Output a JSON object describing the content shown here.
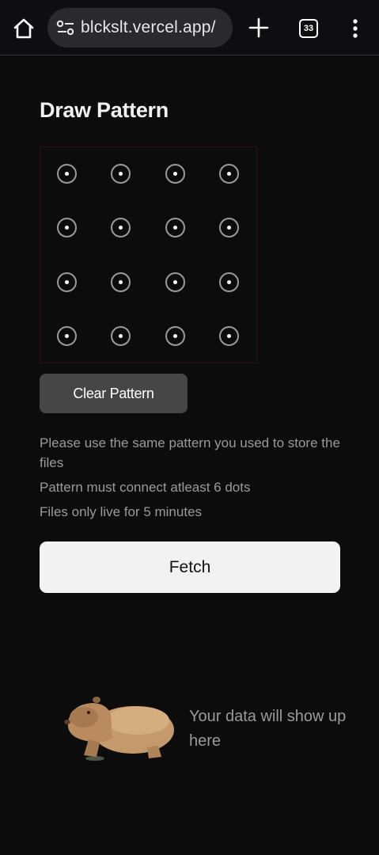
{
  "browser": {
    "url": "blckslt.vercel.app/",
    "tab_count": "33"
  },
  "page": {
    "title": "Draw Pattern",
    "clear_label": "Clear Pattern",
    "info": [
      "Please use the same pattern you used to store the files",
      "Pattern must connect atleast 6 dots",
      "Files only live for 5 minutes"
    ],
    "fetch_label": "Fetch",
    "empty_message": "Your data will show up here"
  },
  "pattern_grid": {
    "rows": 4,
    "cols": 4
  },
  "colors": {
    "background": "#0c0c0c",
    "button_dark": "#464646",
    "button_light": "#f2f2f2",
    "muted_text": "#9a9a9e"
  }
}
